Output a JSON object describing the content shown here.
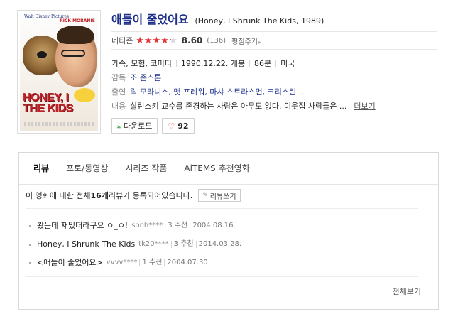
{
  "movie": {
    "title_ko": "애들이 줄었어요",
    "title_orig": "(Honey, I Shrunk The Kids, 1989)",
    "poster": {
      "studio": "Walt Disney Pictures",
      "actor": "RICK MORANIS",
      "title_line1": "HONEY, I",
      "title_line2": "THE KIDS"
    }
  },
  "rating": {
    "label": "네티즌",
    "score": "8.60",
    "score_fraction": 0.86,
    "count": "(136)",
    "rate_label": "평점주기",
    "star_color": "#e8353b"
  },
  "info": {
    "genre": "가족, 모험, 코미디",
    "release": "1990.12.22. 개봉",
    "runtime": "86분",
    "country": "미국",
    "director_label": "감독",
    "director": "조 존스톤",
    "cast_label": "출연",
    "cast": "릭 모라니스, 맷 프레워, 마샤 스트라스먼, 크리스틴 ...",
    "plot_label": "내용",
    "plot": "살린스키 교수를 존경하는 사람은 아무도 없다. 이웃집 사람들은 ...",
    "more_label": "더보기"
  },
  "actions": {
    "download_label": "다운로드",
    "like_count": "92"
  },
  "reviews": {
    "tabs": [
      "리뷰",
      "포토/동영상",
      "시리즈 작품",
      "AiTEMS 추천영화"
    ],
    "summary_pre": "이 영화에 대한 전체 ",
    "summary_count": "16개",
    "summary_post": " 리뷰가 등록되어있습니다.",
    "write_label": "리뷰쓰기",
    "items": [
      {
        "title": "봤는데 재밌더라구요 ㅇ_ㅇ!",
        "user": "sonh****",
        "recommend": "3 추천",
        "date": "2004.08.16."
      },
      {
        "title": "Honey, I Shrunk The Kids",
        "user": "tk20****",
        "recommend": "3 추천",
        "date": "2014.03.28."
      },
      {
        "title": "<애들이 줄었어요>",
        "user": "vvvv****",
        "recommend": "1 추천",
        "date": "2004.07.30."
      }
    ],
    "view_all_label": "전체보기"
  }
}
